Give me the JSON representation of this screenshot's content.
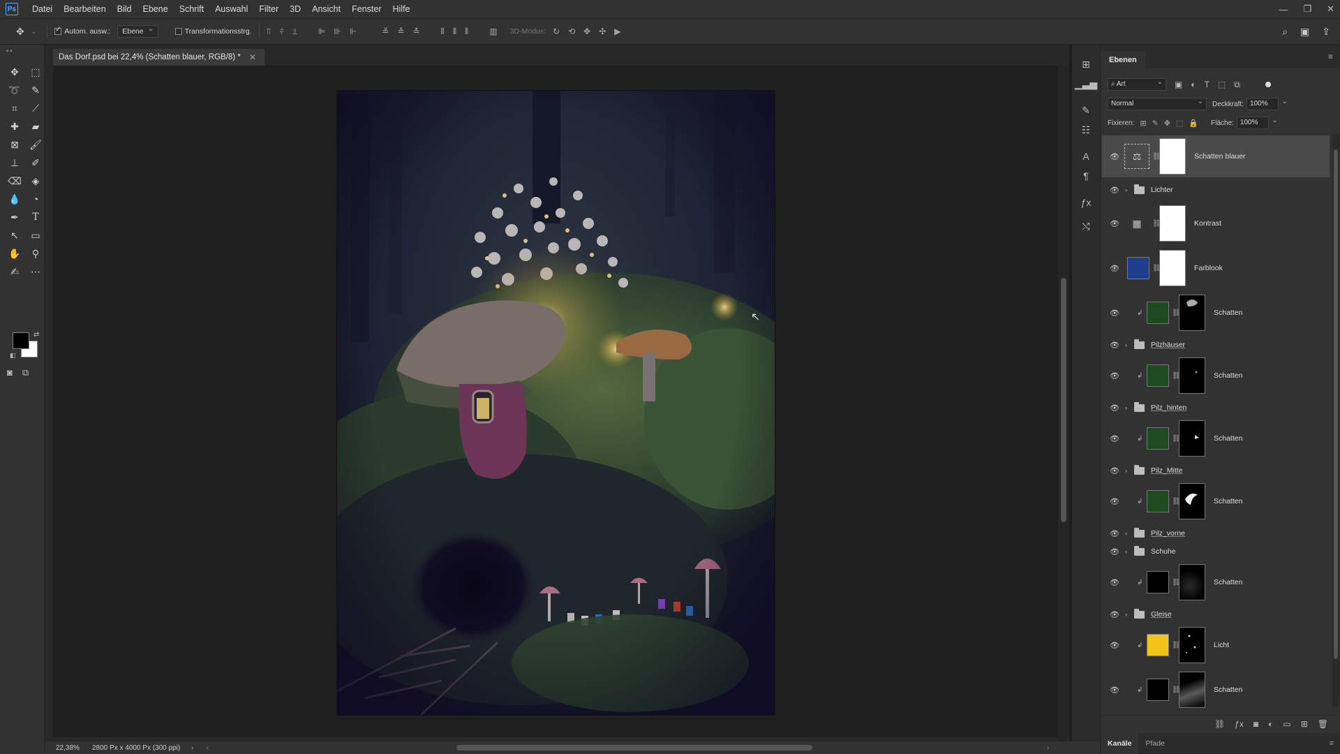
{
  "app": {
    "logo": "Ps"
  },
  "menu": [
    "Datei",
    "Bearbeiten",
    "Bild",
    "Ebene",
    "Schrift",
    "Auswahl",
    "Filter",
    "3D",
    "Ansicht",
    "Fenster",
    "Hilfe"
  ],
  "options": {
    "auto_select_label": "Autom. ausw.:",
    "auto_select_checked": true,
    "auto_select_target": "Ebene",
    "transform_label": "Transformationsstrg.",
    "transform_checked": false,
    "mode_3d_label": "3D-Modus:"
  },
  "document": {
    "tab_title": "Das Dorf.psd bei 22,4% (Schatten blauer, RGB/8) *",
    "zoom": "22,38%",
    "info": "2800 Px x 4000 Px (300 ppi)"
  },
  "colors": {
    "foreground": "#000000",
    "background": "#ffffff",
    "selection": "#4a4a4a"
  },
  "layers_panel": {
    "title": "Ebenen",
    "filter_kind": "Art",
    "blend_mode": "Normal",
    "opacity_label": "Deckkraft:",
    "opacity": "100%",
    "lock_label": "Fixieren:",
    "fill_label": "Fläche:",
    "fill": "100%",
    "layers": [
      {
        "name": "Schatten blauer",
        "kind": "adjustment",
        "icon": "balance-icon",
        "selected": true
      },
      {
        "name": "Lichter",
        "kind": "group",
        "underline": false
      },
      {
        "name": "Kontrast",
        "kind": "adjustment",
        "icon": "curves-icon"
      },
      {
        "name": "Farblook",
        "kind": "fill",
        "fill_color": "#1e3e8c"
      },
      {
        "name": "Schatten",
        "kind": "clipped",
        "fill_color": "#1f4a1f",
        "mask": "mask-fungi"
      },
      {
        "name": "Pilzhäuser",
        "kind": "group",
        "underline": true
      },
      {
        "name": "Schatten",
        "kind": "clipped",
        "fill_color": "#1f4a1f",
        "mask": "mask-dot"
      },
      {
        "name": "Pilz_hinten",
        "kind": "group",
        "underline": true
      },
      {
        "name": "Schatten",
        "kind": "clipped",
        "fill_color": "#1f4a1f",
        "mask": "mask-arrow"
      },
      {
        "name": "Pilz_Mitte",
        "kind": "group",
        "underline": true
      },
      {
        "name": "Schatten",
        "kind": "clipped",
        "fill_color": "#1f4a1f",
        "mask": "mask-swirl"
      },
      {
        "name": "Pilz_vorne",
        "kind": "group",
        "underline": true
      },
      {
        "name": "Schuhe",
        "kind": "group",
        "underline": false
      },
      {
        "name": "Schatten",
        "kind": "clipped",
        "fill_color": "#000000",
        "mask": "mask-glow"
      },
      {
        "name": "Gleise",
        "kind": "group",
        "underline": true
      },
      {
        "name": "Licht",
        "kind": "clipped",
        "fill_color": "#f2c419",
        "mask": "mask-spots"
      },
      {
        "name": "Schatten",
        "kind": "clipped",
        "fill_color": "#000000",
        "mask": "mask-tracks"
      }
    ]
  },
  "bottom_tabs": {
    "channels": "Kanäle",
    "paths": "Pfade"
  }
}
